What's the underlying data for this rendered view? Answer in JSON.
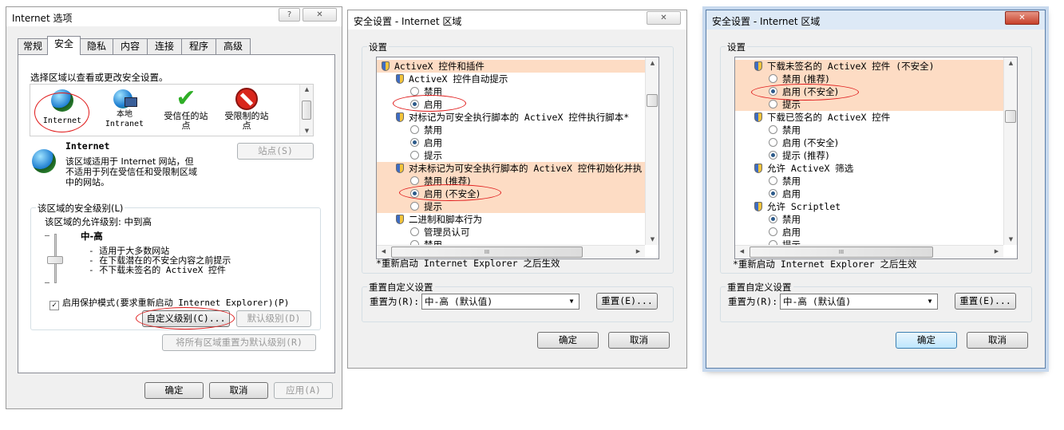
{
  "dialog1": {
    "title": "Internet 选项",
    "help_glyph": "?",
    "close_glyph": "✕",
    "tabs": [
      "常规",
      "安全",
      "隐私",
      "内容",
      "连接",
      "程序",
      "高级"
    ],
    "zone_prompt": "选择区域以查看或更改安全设置。",
    "zones": [
      {
        "label": "Internet"
      },
      {
        "label": "本地\nIntranet"
      },
      {
        "label": "受信任的站\n点"
      },
      {
        "label": "受限制的站\n点"
      }
    ],
    "zone_name": "Internet",
    "zone_description": "该区域适用于 Internet 网站，但\n不适用于列在受信任和受限制区域\n中的网站。",
    "sites_button": "站点(S)",
    "security_level_group": "该区域的安全级别(L)",
    "allowed_levels": "该区域的允许级别: 中到高",
    "level_name": "中-高",
    "level_points": [
      "- 适用于大多数网站",
      "- 在下载潜在的不安全内容之前提示",
      "- 不下载未签名的 ActiveX 控件"
    ],
    "slider_level": 2,
    "protected_mode": {
      "label": "启用保护模式(要求重新启动 Internet Explorer)(P)",
      "checked": true
    },
    "custom_level_button": "自定义级别(C)...",
    "default_level_button": "默认级别(D)",
    "reset_all_button": "将所有区域重置为默认级别(R)",
    "ok": "确定",
    "cancel": "取消",
    "apply": "应用(A)"
  },
  "dialog2": {
    "title": "安全设置 - Internet 区域",
    "close_glyph": "✕",
    "settings_label": "设置",
    "settings_rows": [
      {
        "type": "category",
        "text": "ActiveX 控件和插件",
        "highlight": true
      },
      {
        "type": "setting",
        "text": "ActiveX 控件自动提示"
      },
      {
        "type": "option",
        "text": "禁用",
        "selected": false
      },
      {
        "type": "option",
        "text": "启用",
        "selected": true
      },
      {
        "type": "setting",
        "text": "对标记为可安全执行脚本的 ActiveX 控件执行脚本*"
      },
      {
        "type": "option",
        "text": "禁用",
        "selected": false
      },
      {
        "type": "option",
        "text": "启用",
        "selected": true
      },
      {
        "type": "option",
        "text": "提示",
        "selected": false
      },
      {
        "type": "setting",
        "text": "对未标记为可安全执行脚本的 ActiveX 控件初始化并执",
        "highlight": true
      },
      {
        "type": "option",
        "text": "禁用 (推荐)",
        "selected": false,
        "highlight": true
      },
      {
        "type": "option",
        "text": "启用 (不安全)",
        "selected": true,
        "highlight": true
      },
      {
        "type": "option",
        "text": "提示",
        "selected": false,
        "highlight": true
      },
      {
        "type": "setting",
        "text": "二进制和脚本行为"
      },
      {
        "type": "option",
        "text": "管理员认可",
        "selected": false
      },
      {
        "type": "option",
        "text": "禁用",
        "selected": false
      }
    ],
    "hscroll_grip": "III",
    "restart_note": "*重新启动 Internet Explorer 之后生效",
    "reset_group": "重置自定义设置",
    "reset_to_label": "重置为(R):",
    "reset_select": "中-高 (默认值)",
    "reset_button": "重置(E)...",
    "ok": "确定",
    "cancel": "取消"
  },
  "dialog3": {
    "title": "安全设置 - Internet 区域",
    "close_glyph": "✕",
    "settings_label": "设置",
    "settings_rows": [
      {
        "type": "setting",
        "text": "下载未签名的 ActiveX 控件 (不安全)",
        "highlight": true
      },
      {
        "type": "option",
        "text": "禁用 (推荐)",
        "selected": false,
        "highlight": true
      },
      {
        "type": "option",
        "text": "启用 (不安全)",
        "selected": true,
        "highlight": true
      },
      {
        "type": "option",
        "text": "提示",
        "selected": false,
        "highlight": true
      },
      {
        "type": "setting",
        "text": "下载已签名的 ActiveX 控件"
      },
      {
        "type": "option",
        "text": "禁用",
        "selected": false
      },
      {
        "type": "option",
        "text": "启用 (不安全)",
        "selected": false
      },
      {
        "type": "option",
        "text": "提示 (推荐)",
        "selected": true
      },
      {
        "type": "setting",
        "text": "允许 ActiveX 筛选"
      },
      {
        "type": "option",
        "text": "禁用",
        "selected": false
      },
      {
        "type": "option",
        "text": "启用",
        "selected": true
      },
      {
        "type": "setting",
        "text": "允许 Scriptlet"
      },
      {
        "type": "option",
        "text": "禁用",
        "selected": true
      },
      {
        "type": "option",
        "text": "启用",
        "selected": false
      },
      {
        "type": "option",
        "text": "提示",
        "selected": false
      }
    ],
    "hscroll_grip": "III",
    "restart_note": "*重新启动 Internet Explorer 之后生效",
    "reset_group": "重置自定义设置",
    "reset_to_label": "重置为(R):",
    "reset_select": "中-高 (默认值)",
    "reset_button": "重置(E)...",
    "ok": "确定",
    "cancel": "取消"
  }
}
